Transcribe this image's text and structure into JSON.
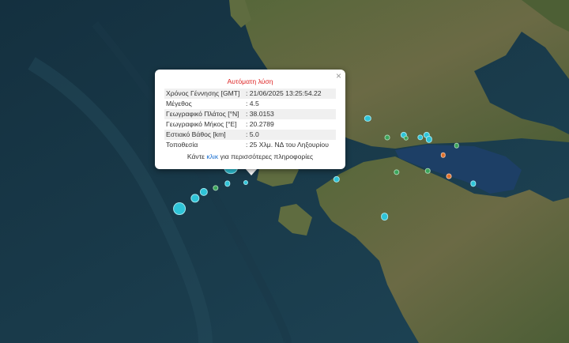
{
  "popup": {
    "title": "Αυτόματη λύση",
    "close_glyph": "×",
    "rows": [
      {
        "label": "Χρόνος Γέννησης [GMT]",
        "value": ": 21/06/2025 13:25:54.22"
      },
      {
        "label": "Μέγεθος",
        "value": ": 4.5"
      },
      {
        "label": "Γεωγραφικό Πλάτος [°N]",
        "value": ": 38.0153"
      },
      {
        "label": "Γεωγραφικό Μήκος [°E]",
        "value": ": 20.2789"
      },
      {
        "label": "Εστιακό Βάθος [km]",
        "value": ": 5.0"
      },
      {
        "label": "Τοποθεσία",
        "value": ": 25 Χλμ. ΝΔ του Ληξουρίου"
      }
    ],
    "more_prefix": "Κάντε ",
    "more_link": "κλικ",
    "more_suffix": " για περισσότερες πληροφορίες"
  },
  "colors": {
    "recent": "#2ec4d8",
    "older_green": "#3aa55a",
    "older_orange": "#e0702a",
    "sea": "#1b3a4b",
    "land": "#5a6b3a"
  },
  "quakes": [
    {
      "lat": 38.0153,
      "lon": 20.2789,
      "mag": 4.5,
      "color": "recent"
    },
    {
      "lat": 37.62,
      "lon": 19.85,
      "mag": 4.2,
      "color": "recent"
    },
    {
      "lat": 37.72,
      "lon": 19.98,
      "mag": 3.4,
      "color": "recent"
    },
    {
      "lat": 37.78,
      "lon": 20.05,
      "mag": 3.2,
      "color": "recent"
    },
    {
      "lat": 37.82,
      "lon": 20.15,
      "mag": 2.6,
      "color": "older_green"
    },
    {
      "lat": 37.86,
      "lon": 20.25,
      "mag": 2.6,
      "color": "recent"
    },
    {
      "lat": 37.87,
      "lon": 20.4,
      "mag": 2.3,
      "color": "recent"
    },
    {
      "lat": 38.82,
      "lon": 20.83,
      "mag": 2.8,
      "color": "recent"
    },
    {
      "lat": 38.48,
      "lon": 21.42,
      "mag": 2.8,
      "color": "recent"
    },
    {
      "lat": 38.3,
      "lon": 21.58,
      "mag": 2.5,
      "color": "older_green"
    },
    {
      "lat": 38.32,
      "lon": 21.72,
      "mag": 2.8,
      "color": "recent"
    },
    {
      "lat": 38.3,
      "lon": 21.86,
      "mag": 2.6,
      "color": "recent"
    },
    {
      "lat": 38.32,
      "lon": 21.91,
      "mag": 2.8,
      "color": "recent"
    },
    {
      "lat": 38.28,
      "lon": 21.93,
      "mag": 2.8,
      "color": "recent"
    },
    {
      "lat": 38.29,
      "lon": 21.74,
      "mag": 2.4,
      "color": "older_green"
    },
    {
      "lat": 38.22,
      "lon": 22.16,
      "mag": 2.4,
      "color": "older_green"
    },
    {
      "lat": 38.13,
      "lon": 22.05,
      "mag": 2.4,
      "color": "older_orange"
    },
    {
      "lat": 37.9,
      "lon": 21.16,
      "mag": 2.8,
      "color": "recent"
    },
    {
      "lat": 37.97,
      "lon": 21.66,
      "mag": 2.6,
      "color": "older_green"
    },
    {
      "lat": 37.98,
      "lon": 21.92,
      "mag": 2.4,
      "color": "older_green"
    },
    {
      "lat": 37.93,
      "lon": 22.1,
      "mag": 2.5,
      "color": "older_orange"
    },
    {
      "lat": 37.86,
      "lon": 22.3,
      "mag": 2.6,
      "color": "recent"
    },
    {
      "lat": 37.55,
      "lon": 21.56,
      "mag": 3.1,
      "color": "recent"
    }
  ]
}
